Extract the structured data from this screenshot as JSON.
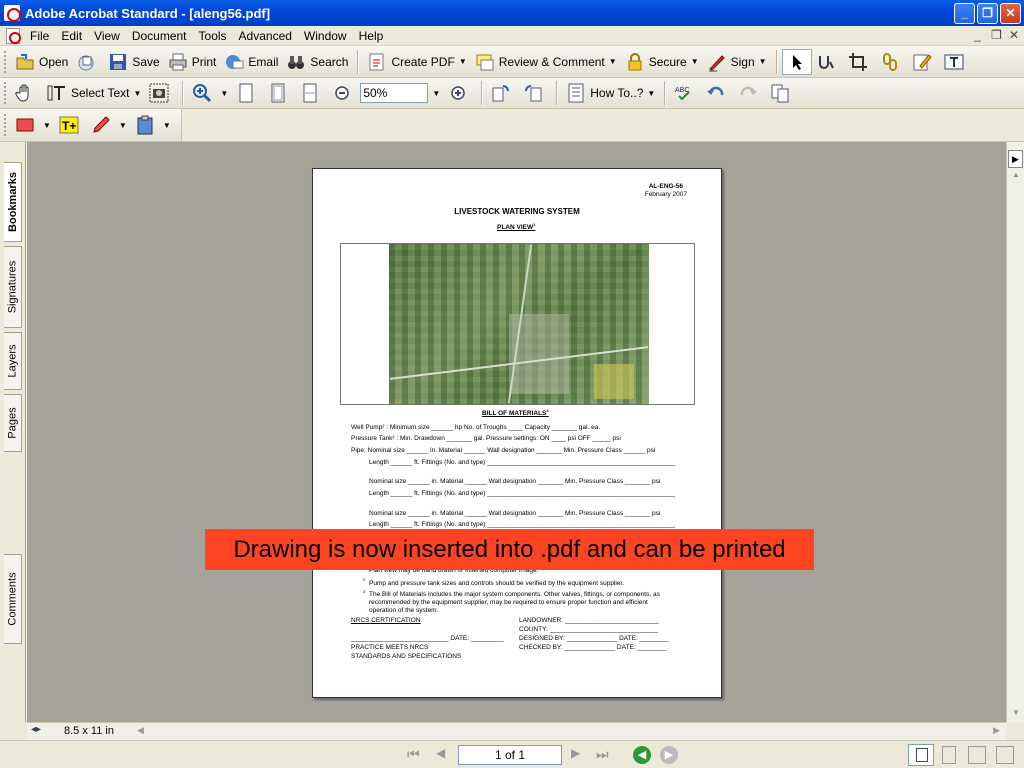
{
  "window": {
    "title": "Adobe Acrobat Standard - [aleng56.pdf]"
  },
  "menu": [
    "File",
    "Edit",
    "View",
    "Document",
    "Tools",
    "Advanced",
    "Window",
    "Help"
  ],
  "toolbar1": {
    "open": "Open",
    "save": "Save",
    "print": "Print",
    "email": "Email",
    "search": "Search",
    "create_pdf": "Create PDF",
    "review": "Review & Comment",
    "secure": "Secure",
    "sign": "Sign"
  },
  "toolbar2": {
    "select_text": "Select Text",
    "zoom": "50%",
    "how_to": "How To..?"
  },
  "side_tabs": [
    "Bookmarks",
    "Signatures",
    "Layers",
    "Pages",
    "Comments"
  ],
  "status": {
    "page_size": "8.5 x 11 in",
    "page_indicator": "1 of 1"
  },
  "banner": "Drawing is now inserted into .pdf and can be printed",
  "document": {
    "code": "AL-ENG-56",
    "date": "February 2007",
    "title": "LIVESTOCK WATERING SYSTEM",
    "plan_view": "PLAN VIEW",
    "plan_view_sup": "1",
    "bill": "BILL OF MATERIALS",
    "bill_sup": "3",
    "lines": [
      "Well Pump² :  Minimum size ______ hp          No. of Troughs ____          Capacity _______ gal. ea.",
      "Pressure Tank² :  Min. Drawdown _______ gal.                  Pressure settings:  ON ____ psi      OFF _____ psi",
      "Pipe:  Nominal size ______ in.      Material ______        Wall designation _______      Min. Pressure Class ______ psi",
      "Length ______ ft.        Fittings (No. and type) ____________________________________________________",
      "Nominal size ______ in.      Material ______        Wall designation _______      Min. Pressure Class _______ psi",
      "Length ______ ft.        Fittings (No. and type) ____________________________________________________",
      "Nominal size ______ in.      Material ______        Wall designation _______      Min. Pressure Class _______ psi",
      "Length ______ ft.        Fittings (No. and type) ____________________________________________________"
    ],
    "note1": "Plan view may be hand drawn or inserted computer image.",
    "note2": "Pump and pressure tank sizes and controls should be verified by the equipment supplier.",
    "note3a": "The Bill of Materials includes the major system components.  Other valves, fittings, or components, as",
    "note3b": "recommended by the equipment supplier, may be required to ensure proper function and efficient",
    "note3c": "operation of the system.",
    "nrcs_cert": "NRCS CERTIFICATION",
    "date_line": "___________________________  DATE: _________",
    "practice1": "PRACTICE MEETS NRCS",
    "practice2": "STANDARDS AND SPECIFICATIONS",
    "landowner": "LANDOWNER: __________________________",
    "county": "COUNTY: ______________________________",
    "designed": "DESIGNED BY: ______________  DATE: ________",
    "checked": "CHECKED BY: ______________  DATE: ________"
  }
}
